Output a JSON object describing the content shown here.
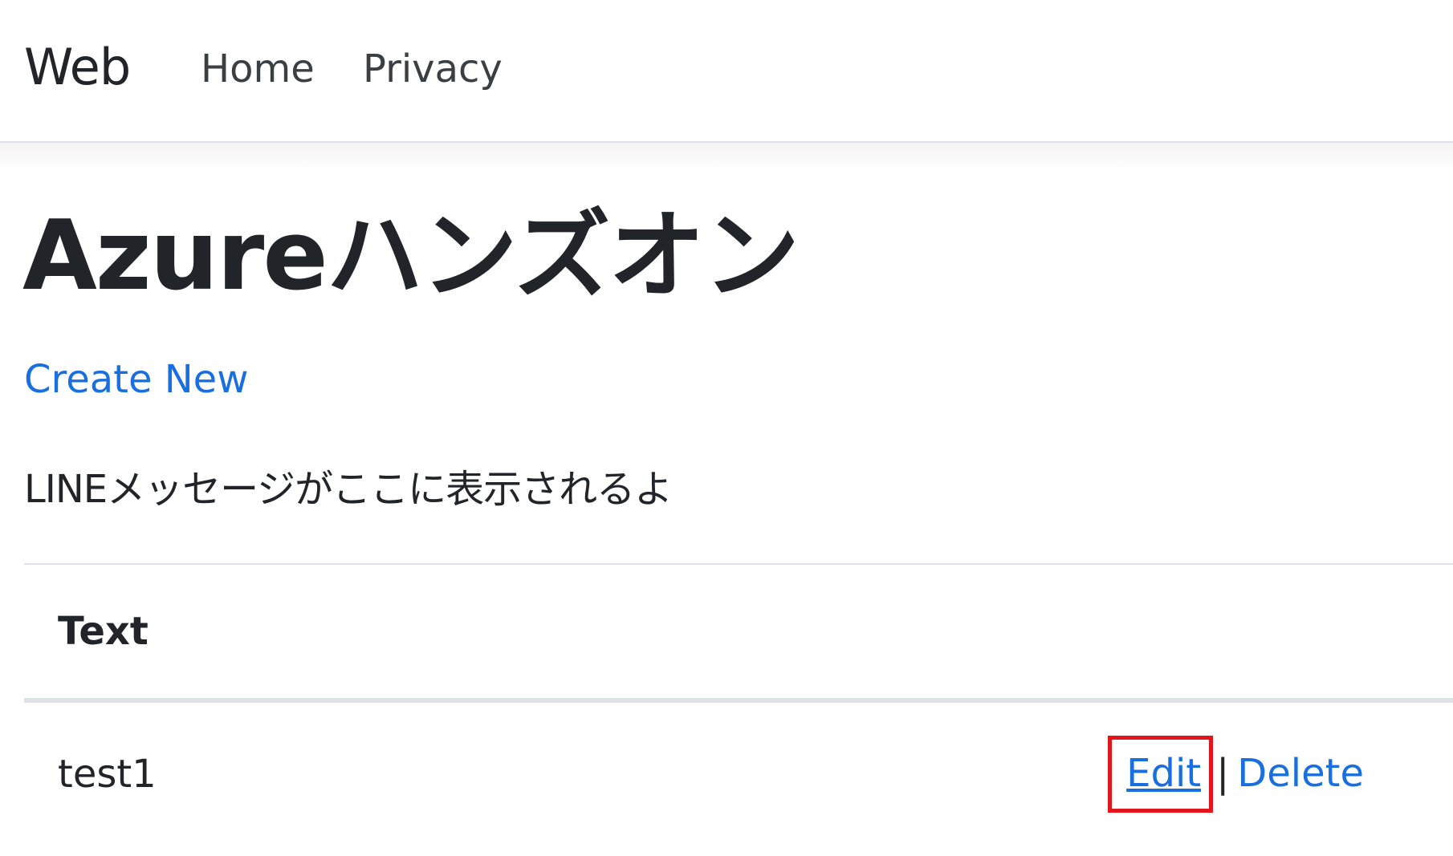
{
  "navbar": {
    "brand": "Web",
    "links": [
      "Home",
      "Privacy"
    ]
  },
  "page": {
    "title": "Azureハンズオン",
    "create_link": "Create New",
    "message": "LINEメッセージがここに表示されるよ"
  },
  "table": {
    "columns": [
      "Text"
    ],
    "rows": [
      {
        "text": "test1",
        "actions": [
          "Edit",
          "Delete"
        ],
        "separator": "|"
      }
    ]
  },
  "colors": {
    "link": "#1a6fe0",
    "highlight": "#e3151a",
    "text": "#212529"
  }
}
